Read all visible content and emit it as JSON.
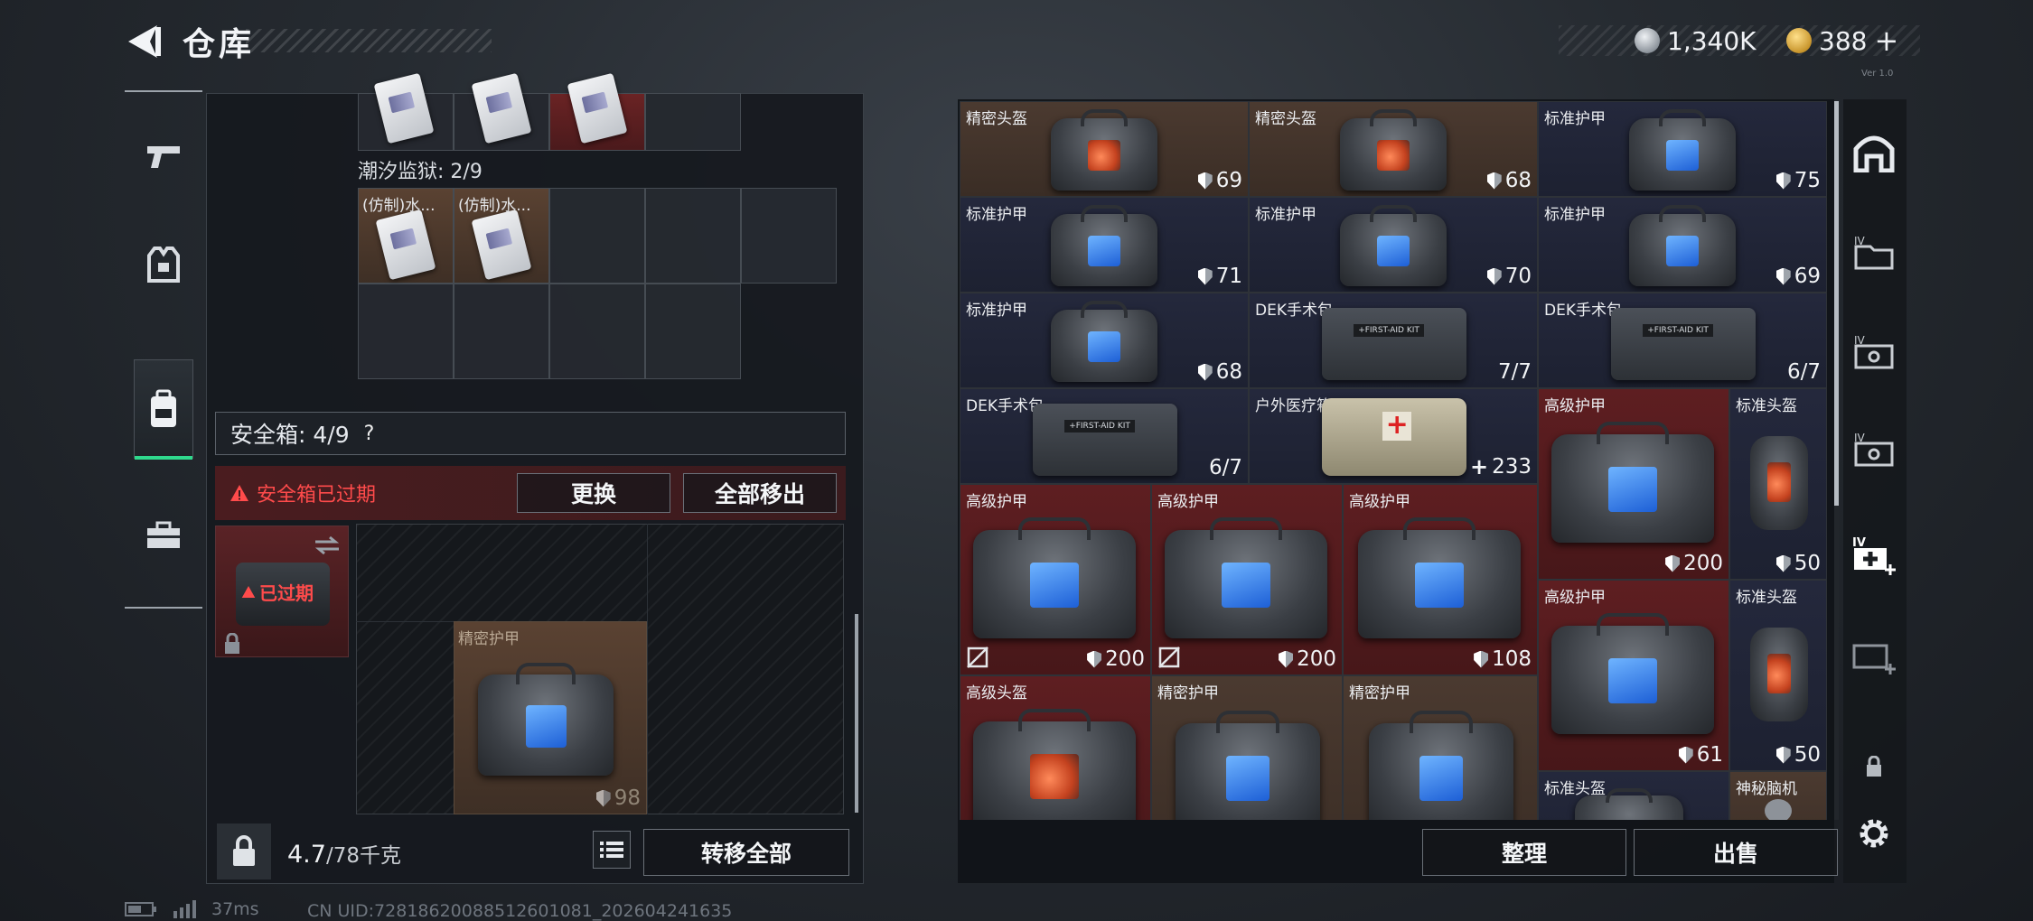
{
  "header": {
    "title": "仓库",
    "currency_silver": "1,340K",
    "currency_gold": "388",
    "gold_plus": "+",
    "version": "Ver 1.0"
  },
  "left_rail": {
    "items": [
      "weapons",
      "equipment",
      "backpack",
      "toolbox"
    ],
    "active": "backpack"
  },
  "container": {
    "prison_label": "潮汐监狱: 2/9",
    "prison_items": [
      "(仿制)水...",
      "(仿制)水..."
    ]
  },
  "safebox": {
    "label": "安全箱: 4/9",
    "help": "?",
    "expired_warning": "安全箱已过期",
    "replace_button": "更换",
    "move_all_out_button": "全部移出",
    "slot_expired": "已过期",
    "item_name": "精密护甲",
    "item_value": "98"
  },
  "bottom_left": {
    "weight": "4.7",
    "weight_cap": "/78千克",
    "transfer_all_button": "转移全部"
  },
  "stash": {
    "items": [
      {
        "name": "精密头盔",
        "value": "69",
        "kind": "shield"
      },
      {
        "name": "精密头盔",
        "value": "68",
        "kind": "shield"
      },
      {
        "name": "标准护甲",
        "value": "75",
        "kind": "shield"
      },
      {
        "name": "标准护甲",
        "value": "71",
        "kind": "shield"
      },
      {
        "name": "标准护甲",
        "value": "70",
        "kind": "shield"
      },
      {
        "name": "标准护甲",
        "value": "69",
        "kind": "shield"
      },
      {
        "name": "标准护甲",
        "value": "68",
        "kind": "shield"
      },
      {
        "name": "DEK手术包",
        "value": "7/7",
        "kind": "count"
      },
      {
        "name": "DEK手术包",
        "value": "6/7",
        "kind": "count"
      },
      {
        "name": "DEK手术包",
        "value": "6/7",
        "kind": "count"
      },
      {
        "name": "户外医疗箱",
        "value": "233",
        "kind": "plus"
      },
      {
        "name": "高级护甲",
        "value": "200",
        "kind": "shield"
      },
      {
        "name": "标准头盔",
        "value": "50",
        "kind": "shield"
      },
      {
        "name": "高级护甲",
        "value": "200",
        "kind": "shield"
      },
      {
        "name": "高级护甲",
        "value": "200",
        "kind": "shield"
      },
      {
        "name": "高级护甲",
        "value": "108",
        "kind": "shield"
      },
      {
        "name": "高级护甲",
        "value": "61",
        "kind": "shield"
      },
      {
        "name": "标准头盔",
        "value": "50",
        "kind": "shield"
      },
      {
        "name": "高级头盔",
        "value": "",
        "kind": "none"
      },
      {
        "name": "精密护甲",
        "value": "",
        "kind": "none"
      },
      {
        "name": "精密护甲",
        "value": "",
        "kind": "none"
      },
      {
        "name": "标准头盔",
        "value": "",
        "kind": "none"
      },
      {
        "name": "神秘脑机",
        "value": "",
        "kind": "none"
      }
    ],
    "sort_button": "整理",
    "sell_button": "出售"
  },
  "footer": {
    "ping": "37ms",
    "uid": "CN UID:7281862008851260​1081_202604241635"
  },
  "colors": {
    "accent_green": "#2fd98d",
    "warning_red": "#ff4b4b",
    "tier_red": "#5e1e21",
    "tier_brown": "#4b3a30",
    "tier_navy": "#24283c"
  }
}
